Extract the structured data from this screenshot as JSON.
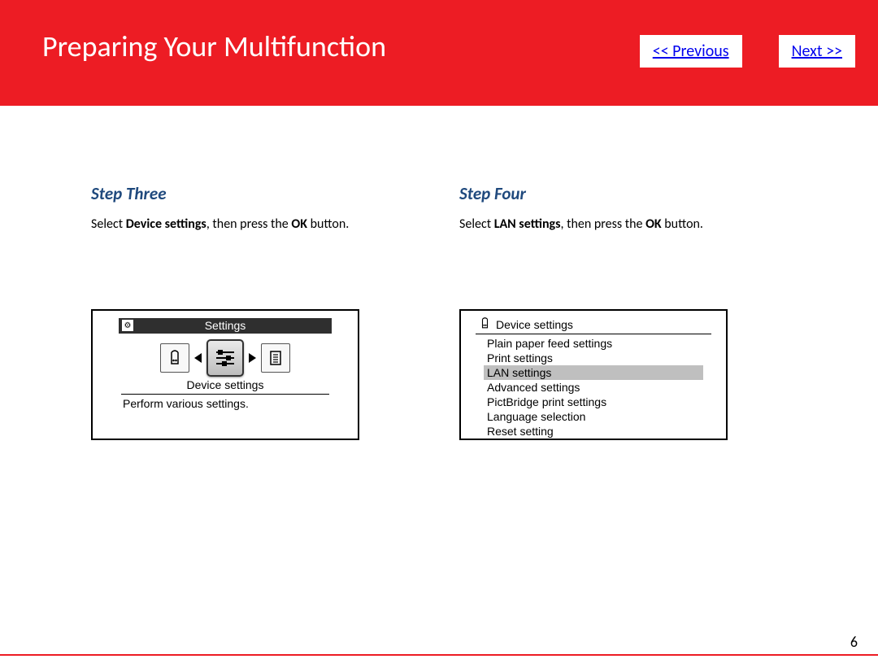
{
  "header": {
    "title": "Preparing Your Multifunction",
    "prev_label": "<< Previous",
    "next_label": "Next >>"
  },
  "step3": {
    "label": "Step Three",
    "desc_pre": "Select ",
    "desc_b1": "Device settings",
    "desc_mid": ", then press the ",
    "desc_b2": "OK",
    "desc_post": " button.",
    "lcd": {
      "bar_title": "Settings",
      "selected_label": "Device settings",
      "hint": "Perform various settings."
    }
  },
  "step4": {
    "label": "Step Four",
    "desc_pre": "Select ",
    "desc_b1": "LAN settings",
    "desc_mid": ", then press the ",
    "desc_b2": "OK",
    "desc_post": " button.",
    "lcd": {
      "header": "Device settings",
      "items": {
        "i0": "Plain paper feed settings",
        "i1": "Print settings",
        "i2": "LAN settings",
        "i3": "Advanced settings",
        "i4": "PictBridge print settings",
        "i5": "Language selection",
        "i6": "Reset setting"
      }
    }
  },
  "page_number": "6"
}
